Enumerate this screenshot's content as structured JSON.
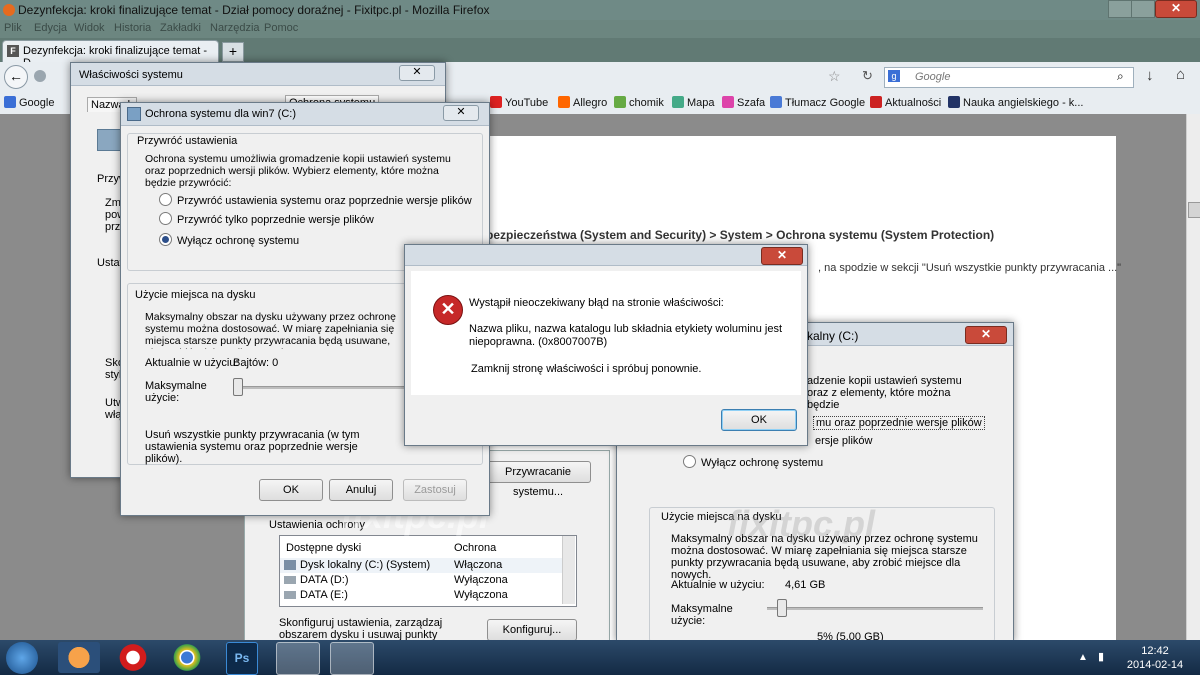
{
  "window": {
    "title": "Dezynfekcja: kroki finalizujące temat - Dział pomocy doraźnej - Fixitpc.pl - Mozilla Firefox"
  },
  "menu": [
    "Plik",
    "Edycja",
    "Widok",
    "Historia",
    "Zakładki",
    "Narzędzia",
    "Pomoc"
  ],
  "tab": {
    "label": "Dezynfekcja: kroki finalizujące temat - D...",
    "new_tab": "+"
  },
  "search": {
    "placeholder": "Google"
  },
  "bookmarks": [
    "Google",
    "YouTube",
    "Allegro",
    "chomik",
    "Mapa",
    "Szafa",
    "Tłumacz Google",
    "Aktualności",
    "Nauka angielskiego - k..."
  ],
  "page": {
    "heading": "bezpieczeństwa (System and Security) > System > Ochrona systemu (System Protection)",
    "line": ", na spodzie w sekcji \"Usuń wszystkie punkty przywracania ...\""
  },
  "sysprops": {
    "title": "Właściwości systemu",
    "tabs": [
      "Nazwa k",
      "Ochrona systemu"
    ],
    "left_texts": [
      "Przyw",
      "Zmi",
      "pow",
      "przy",
      "Ustaw",
      "Skor",
      "styk",
      "Utw",
      "włą"
    ]
  },
  "protect_dlg": {
    "title": "Ochrona systemu dla win7 (C:)",
    "restore_group": "Przywróć ustawienia",
    "restore_desc": "Ochrona systemu umożliwia gromadzenie kopii ustawień systemu oraz poprzednich wersji plików. Wybierz elementy, które można będzie przywrócić:",
    "options": [
      "Przywróć ustawienia systemu oraz poprzednie wersje plików",
      "Przywróć tylko poprzednie wersje plików",
      "Wyłącz ochronę systemu"
    ],
    "selected_index": 2,
    "disk_group": "Użycie miejsca na dysku",
    "disk_desc": "Maksymalny obszar na dysku używany przez ochronę systemu można dostosować. W miarę zapełniania się miejsca starsze punkty przywracania będą usuwane, aby zrobić miejsce dla nowych.",
    "current_label": "Aktualnie w użyciu:",
    "current_value": "Bajtów: 0",
    "max_label": "Maksymalne użycie:",
    "slider_fraction": 0,
    "delete_desc": "Usuń wszystkie punkty przywracania (w tym ustawienia systemu oraz poprzednie wersje plików).",
    "ok": "OK",
    "cancel": "Anuluj",
    "apply": "Zastosuj"
  },
  "error_dlg": {
    "title": "",
    "message1": "Wystąpił nieoczekiwany błąd na stronie właściwości:",
    "message2": "Nazwa pliku, nazwa katalogu lub składnia etykiety woluminu jest niepoprawna. (0x8007007B)",
    "message3": "Zamknij stronę właściwości i spróbuj ponownie.",
    "ok": "OK"
  },
  "bottom_panel": {
    "restore_button": "Przywracanie systemu...",
    "settings_group": "Ustawienia ochrony",
    "columns": [
      "Dostępne dyski",
      "Ochrona"
    ],
    "rows": [
      {
        "disk": "Dysk lokalny (C:) (System)",
        "status": "Włączona"
      },
      {
        "disk": "DATA (D:)",
        "status": "Wyłączona"
      },
      {
        "disk": "DATA (E:)",
        "status": "Wyłączona"
      }
    ],
    "configure_desc": "Skonfiguruj ustawienia, zarządzaj obszarem dysku i usuwaj punkty przywracania.",
    "configure_button": "Konfiguruj..."
  },
  "right_dlg": {
    "title": "kalny (C:)",
    "desc_partial": "adzenie kopii ustawień systemu oraz z elementy, które można będzie",
    "opt1_partial": "mu oraz poprzednie wersje plików",
    "opt2_partial": "ersje plików",
    "opt3": "Wyłącz ochronę systemu",
    "disk_group": "Użycie miejsca na dysku",
    "disk_desc": "Maksymalny obszar na dysku używany przez ochronę systemu można dostosować. W miarę zapełniania się miejsca starsze punkty przywracania będą usuwane, aby zrobić miejsce dla nowych.",
    "current_label": "Aktualnie w użyciu:",
    "current_value": "4,61 GB",
    "max_label": "Maksymalne użycie:",
    "slider_fraction": 0.05,
    "percent": "5% (5,00 GB)"
  },
  "watermark": "fixitpc.pl",
  "clock": {
    "time": "12:42",
    "date": "2014-02-14"
  },
  "colors": {
    "error_red": "#c62828",
    "taskbar": "#1b3452",
    "accent": "#3c7fb1"
  }
}
